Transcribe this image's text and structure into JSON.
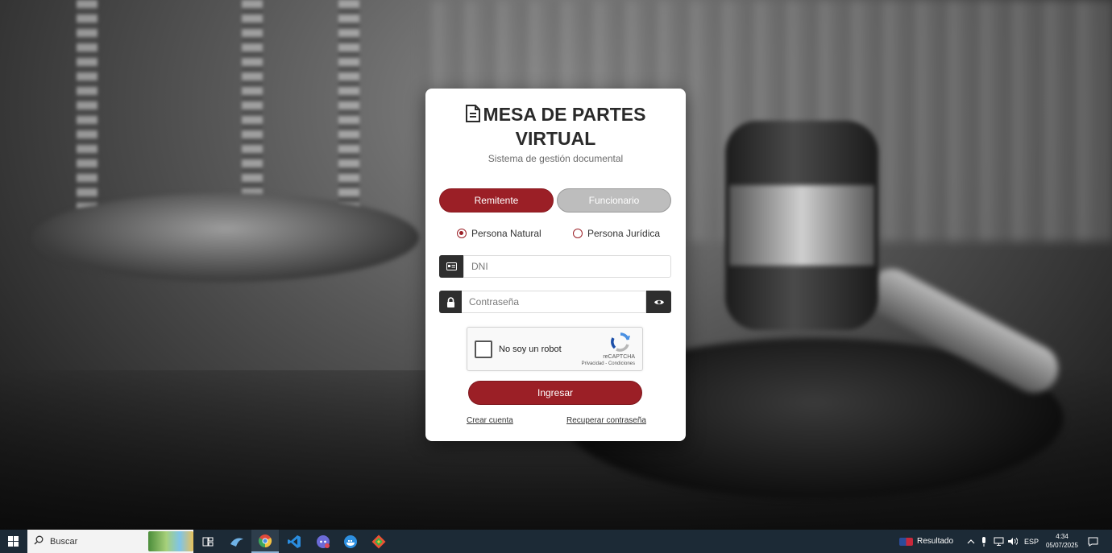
{
  "login": {
    "title_line1": "MESA DE PARTES",
    "title_line2": "VIRTUAL",
    "subtitle": "Sistema de gestión documental",
    "tabs": {
      "remitente": "Remitente",
      "funcionario": "Funcionario"
    },
    "radios": {
      "natural": "Persona Natural",
      "juridica": "Persona Jurídica",
      "selected": "natural"
    },
    "dni_placeholder": "DNI",
    "password_placeholder": "Contraseña",
    "captcha": {
      "label": "No soy un robot",
      "brand": "reCAPTCHA",
      "terms": "Privacidad - Condiciones"
    },
    "submit_label": "Ingresar",
    "links": {
      "create_account": "Crear cuenta",
      "recover_password": "Recuperar contraseña"
    },
    "accent_color": "#9b1f26"
  },
  "taskbar": {
    "search_label": "Buscar",
    "news_label": "Resultado",
    "language": "ESP",
    "time": "4:34",
    "date": "05/07/2025",
    "apps": [
      "task-view",
      "edge-bird",
      "chrome",
      "vscode",
      "discord",
      "docker",
      "git"
    ]
  }
}
